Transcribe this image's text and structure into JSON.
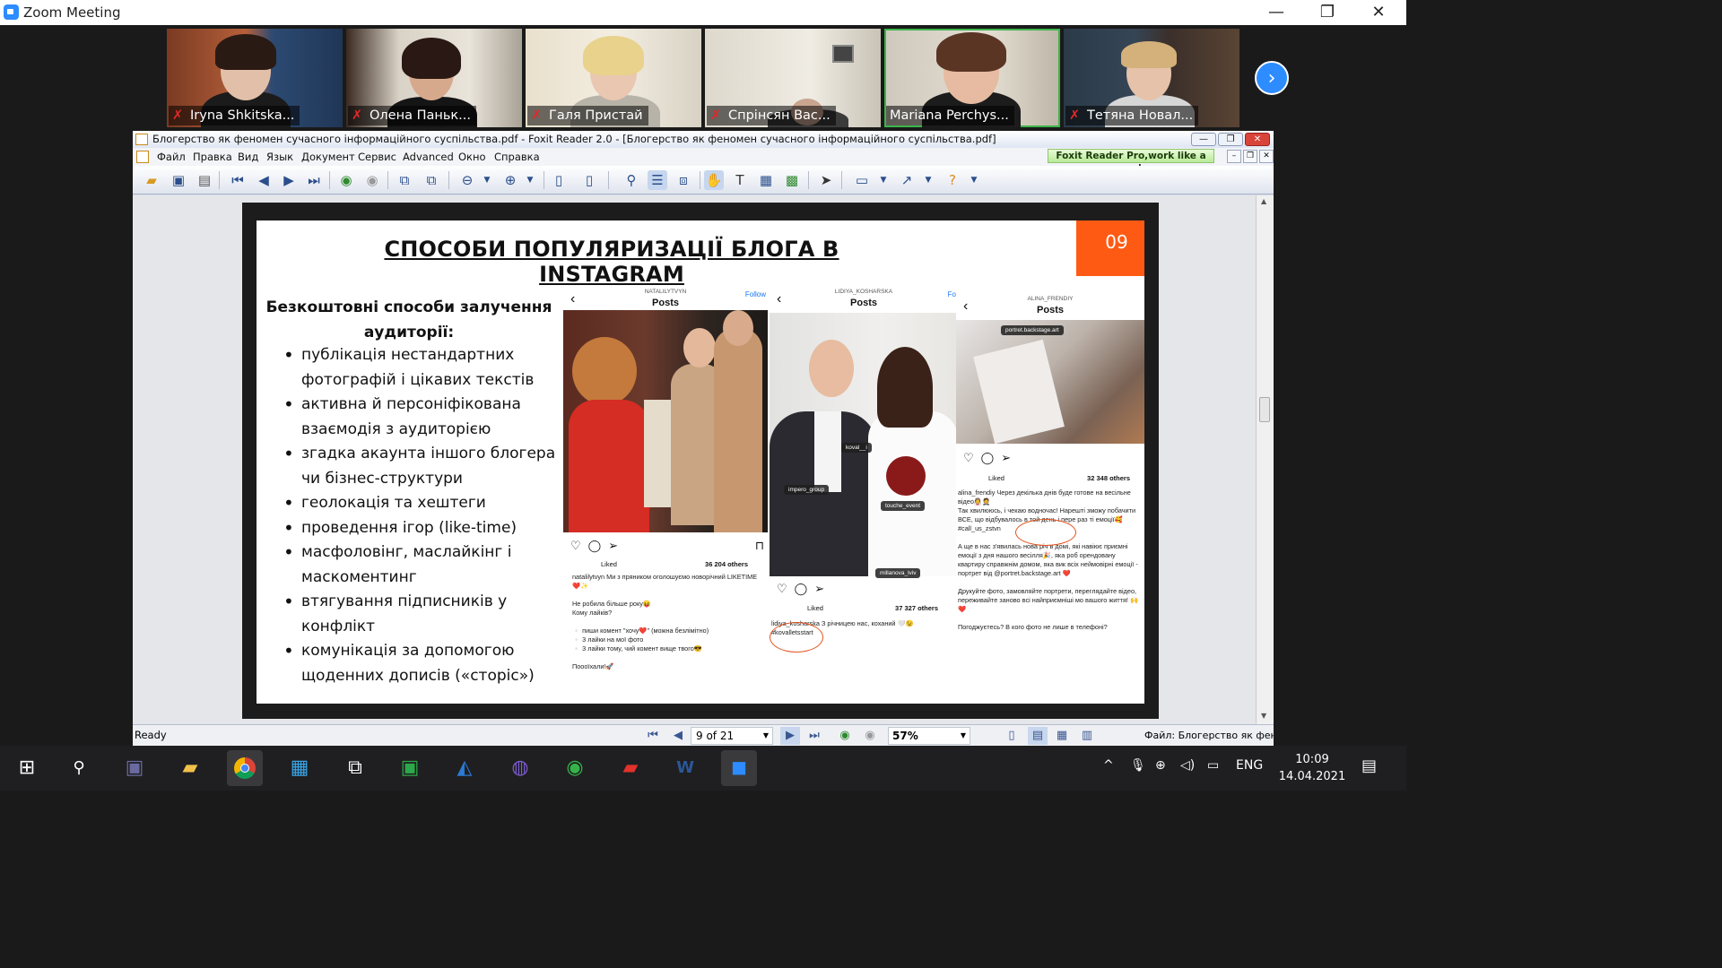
{
  "zoom": {
    "window_title": "Zoom Meeting",
    "controls": {
      "minimize": "—",
      "restore": "❐",
      "close": "✕"
    },
    "participants": [
      {
        "name": "Iryna Shkitska...",
        "muted": true
      },
      {
        "name": "Олена Паньк...",
        "muted": true
      },
      {
        "name": "Галя Пристай",
        "muted": true
      },
      {
        "name": "Спрінсян Вас...",
        "muted": true
      },
      {
        "name": "Mariana Perchys...",
        "muted": false,
        "active": true
      },
      {
        "name": "Тетяна Новал...",
        "muted": true
      }
    ],
    "next_page_icon": "chevron-right-icon",
    "accent": "#2d8cff"
  },
  "foxit": {
    "title": "Блогерство як феномен сучасного інформаційного суспільства.pdf - Foxit Reader 2.0 - [Блогерство як феномен сучасного інформаційного суспільства.pdf]",
    "menu": [
      "Файл",
      "Правка",
      "Вид",
      "Язык",
      "Документ",
      "Сервис",
      "Advanced",
      "Окно",
      "Справка"
    ],
    "promo": "Foxit Reader Pro,work like a pro!",
    "status_left": "Ready",
    "page_indicator": "9 of 21",
    "zoom_level": "57%",
    "status_right": "Файл: Блогерство як феномен"
  },
  "slide": {
    "title": "СПОСОБИ ПОПУЛЯРИЗАЦІЇ БЛОГА В INSTAGRAM",
    "page_number": "09",
    "accent": "#ff5a14",
    "subhead": "Безкоштовні способи залучення аудиторії:",
    "bullets": [
      "публікація нестандартних фотографій і цікавих текстів",
      "активна й персоніфікована взаємодія з аудиторією",
      "згадка акаунта іншого блогера чи бізнес-структури",
      "геолокація та хештеги",
      "проведення ігор (like-time)",
      "масфоловінг, маслайкінг і маскоментинг",
      "втягування підписників у конфлікт",
      "комунікація за допомогою щоденних дописів («сторіс»)"
    ],
    "posts": [
      {
        "user": "NATALILYTVYN",
        "header": "Posts",
        "follow": "Follow",
        "liked": "Liked",
        "likes": "36 204 others",
        "caption": "natalilytvyn Ми з пряником оголошуємо новорічний LIKETIME❤️✨\n\nНе робила більше року😝\nКому лайків?\n\n▫️ пиши комент \"хочу❤️\" (можна безлімітно)\n▫️ 3 лайки на мої фото\n▫️ 3 лайки тому, чий комент вище твого😎\n\nПоооїхали!🚀"
      },
      {
        "user": "LIDIYA_KOSHARSKA",
        "header": "Posts",
        "follow": "Fo",
        "liked": "Liked",
        "likes": "37 327 others",
        "tags": [
          "koval__i",
          "impero_group",
          "touche_event",
          "millanova_lviv"
        ],
        "caption": "lidiya_kosharska З річницею нас, коханий 🤍😉\n#kovalletsstart"
      },
      {
        "user": "ALINA_FRENDIY",
        "header": "Posts",
        "liked": "Liked",
        "likes": "32 348 others",
        "tags": [
          "portret.backstage.art"
        ],
        "caption": "alina_frendiy Через декілька днів буде готове на весільне відео👰🤵\nТак хвилююсь, і чекаю водночас! Нарешті зможу побачити ВСЕ, що відбувалось в той день і пере раз ті емоції🥰 #call_us_zstvn\n\nА ще в нас з'явилась нова річ в домі, які навіює приємні емоції з дня нашого весілля🎉, яка роб орендовану квартиру справжнім домом, яка вик всіх неймовірні емоції - портрет від @portret.backstage.art ❤️\n\nДрукуйте фото, замовляйте портрети, переглядайте відео, переживайте заново всі найприємніші мо вашого життя! 🙌❤️\n\nПогоджуєтесь? В кого фото не лише в телефоні?"
      }
    ]
  },
  "taskbar": {
    "language": "ENG",
    "time": "10:09",
    "date": "14.04.2021"
  }
}
